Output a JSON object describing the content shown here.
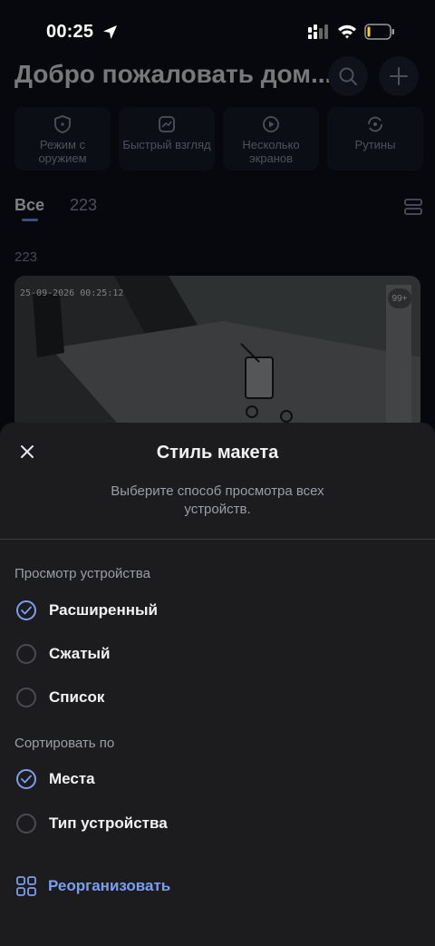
{
  "status_bar": {
    "time": "00:25"
  },
  "home": {
    "title": "Добро пожаловать дом...",
    "quick_actions": [
      {
        "label": "Режим с оружием",
        "icon": "shield-icon"
      },
      {
        "label": "Быстрый взгляд",
        "icon": "glance-icon"
      },
      {
        "label": "Несколько экранов",
        "icon": "play-icon"
      },
      {
        "label": "Рутины",
        "icon": "routine-icon"
      }
    ],
    "tabs": [
      "Все",
      "223"
    ],
    "group_label": "223",
    "camera": {
      "timestamp": "25-09-2026 00:25:12",
      "badge": "99+"
    }
  },
  "sheet": {
    "title": "Стиль макета",
    "subtitle": "Выберите способ просмотра всех устройств.",
    "device_view_label": "Просмотр устройства",
    "device_view_options": [
      {
        "label": "Расширенный",
        "checked": true
      },
      {
        "label": "Сжатый",
        "checked": false
      },
      {
        "label": "Список",
        "checked": false
      }
    ],
    "sort_label": "Сортировать по",
    "sort_options": [
      {
        "label": "Места",
        "checked": true
      },
      {
        "label": "Тип устройства",
        "checked": false
      }
    ],
    "reorganize_label": "Реорганизовать"
  },
  "colors": {
    "accent": "#7c9ef0",
    "sheet_bg": "#1c1c1e"
  }
}
